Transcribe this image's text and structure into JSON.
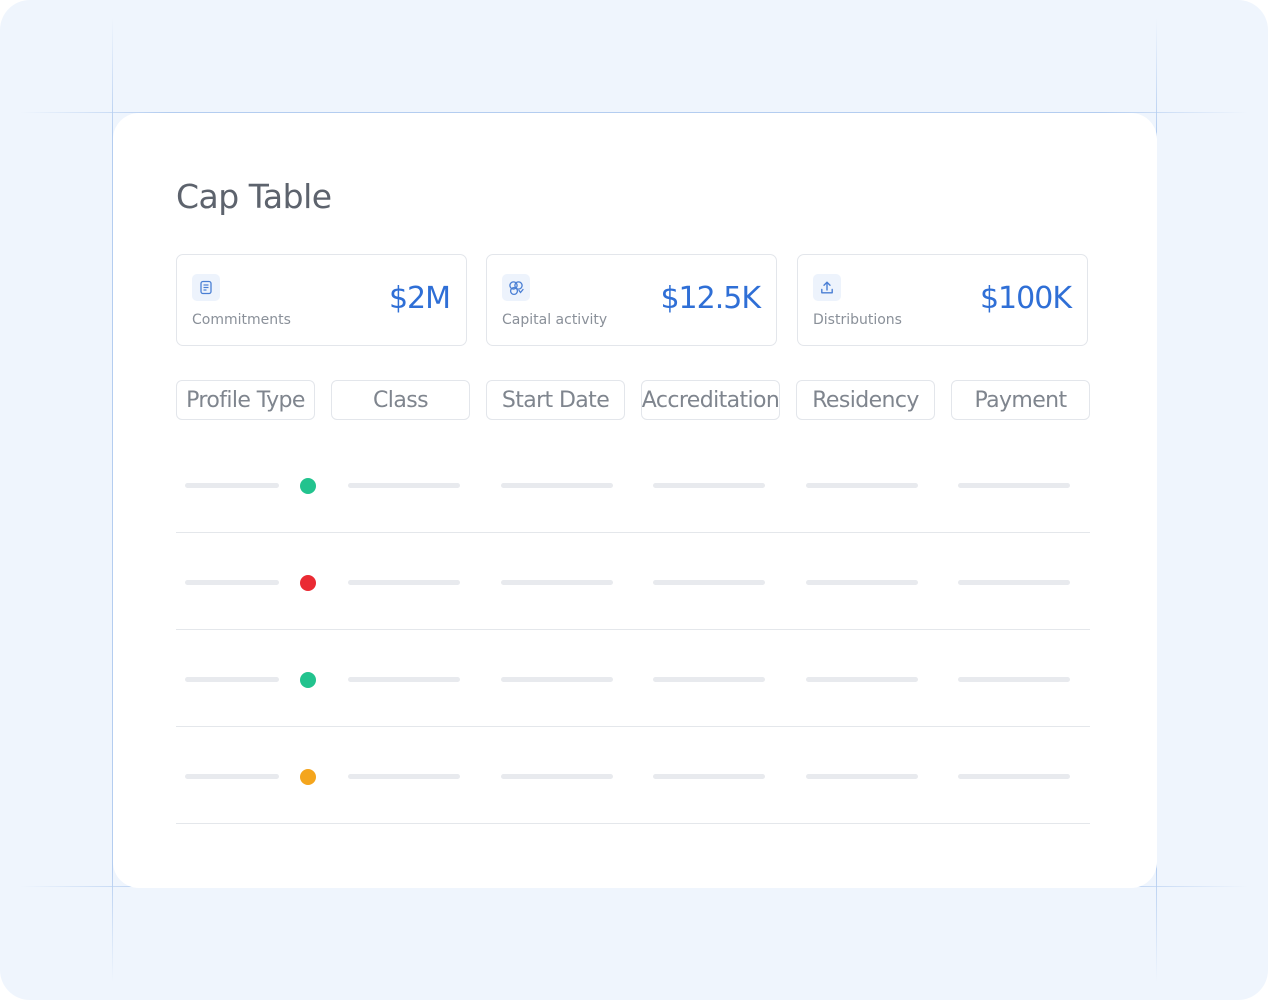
{
  "page": {
    "title": "Cap Table"
  },
  "stats": [
    {
      "label": "Commitments",
      "value": "$2M",
      "icon": "document-icon"
    },
    {
      "label": "Capital activity",
      "value": "$12.5K",
      "icon": "capital-activity-icon"
    },
    {
      "label": "Distributions",
      "value": "$100K",
      "icon": "upload-icon"
    }
  ],
  "filters": [
    {
      "label": "Profile Type"
    },
    {
      "label": "Class"
    },
    {
      "label": "Start Date"
    },
    {
      "label": "Accreditation"
    },
    {
      "label": "Residency"
    },
    {
      "label": "Payment"
    }
  ],
  "rows": [
    {
      "status": "green",
      "status_color": "#22c38e"
    },
    {
      "status": "red",
      "status_color": "#ea2a33"
    },
    {
      "status": "green",
      "status_color": "#22c38e"
    },
    {
      "status": "orange",
      "status_color": "#f4a51d"
    }
  ],
  "colors": {
    "background": "#eff5fd",
    "accent": "#2f6fd6",
    "icon_tint": "#4a7fd4",
    "placeholder": "#e8eaee"
  }
}
